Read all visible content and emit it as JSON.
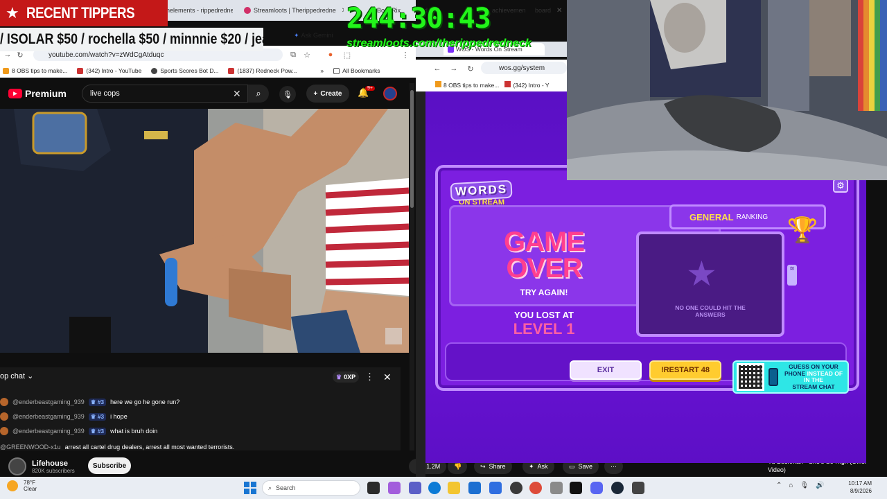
{
  "overlay": {
    "recent_tippers": "RECENT TIPPERS",
    "ticker": "/ ISOLAR $50 / rochella $50 / minnnie $20 / jea",
    "timer": "244:30:43",
    "stream_url": "streamloots.com/therippedredneck"
  },
  "left_browser": {
    "tabs": [
      "Streamelements - rippedredne",
      "Streamloots | Therippedredne",
      "at Bo   otRix",
      "oud St",
      "achievemen",
      "board"
    ],
    "gemini_label": "Ask Gemini",
    "url": "youtube.com/watch?v=zWdCgAtduqc",
    "bookmarks": [
      "8 OBS tips to make...",
      "(342) Intro - YouTube",
      "Sports Scores Bot D...",
      "(1837) Redneck Pow..."
    ],
    "all_bookmarks": "All Bookmarks"
  },
  "youtube": {
    "logo": "Premium",
    "search_value": "live cops",
    "create_label": "Create",
    "notif_badge": "9+",
    "chat": {
      "title": "op chat",
      "xp": "0XP",
      "messages": [
        {
          "user": "@enderbeastgaming_939",
          "rank": "#3",
          "msg": "here we go he gone run?"
        },
        {
          "user": "@enderbeastgaming_939",
          "rank": "#3",
          "msg": "i hope"
        },
        {
          "user": "@enderbeastgaming_939",
          "rank": "#3",
          "msg": "what is bruh doin"
        },
        {
          "user": "@GREENWOOD-x1u",
          "rank": "",
          "msg": "arrest all cartel drug dealers, arrest all most wanted terrorists."
        }
      ]
    },
    "channel_name": "Lifehouse",
    "channel_subs": "820K subscribers",
    "subscribe": "Subscribe",
    "likes": "1.2M",
    "share": "Share",
    "ask": "Ask",
    "save": "Save",
    "next_video": "Yu Buchman - She's So High (Official Video)"
  },
  "right_browser": {
    "tab_title": "WOS - Words On Stream",
    "url": "wos.gg/system",
    "bookmarks": [
      "8 OBS tips to make...",
      "(342) Intro - Y"
    ]
  },
  "game": {
    "logo_top": "WORDS",
    "logo_bottom": "ON STREAM",
    "game_over": "GAME OVER",
    "try_again": "TRY AGAIN!",
    "you_lost": "YOU LOST AT",
    "level": "LEVEL 1",
    "ranking_strong": "GENERAL",
    "ranking_label": "RANKING",
    "no_one": "NO ONE COULD HIT THE ANSWERS",
    "exit": "EXIT",
    "restart": "!RESTART 48",
    "guess_1": "GUESS ON YOUR",
    "guess_2": "PHONE",
    "guess_3": "INSTEAD OF IN THE",
    "guess_4": "STREAM CHAT"
  },
  "taskbar": {
    "temp": "78°F",
    "condition": "Clear",
    "search": "Search",
    "time": "10:17 AM",
    "date": "8/9/2026"
  }
}
